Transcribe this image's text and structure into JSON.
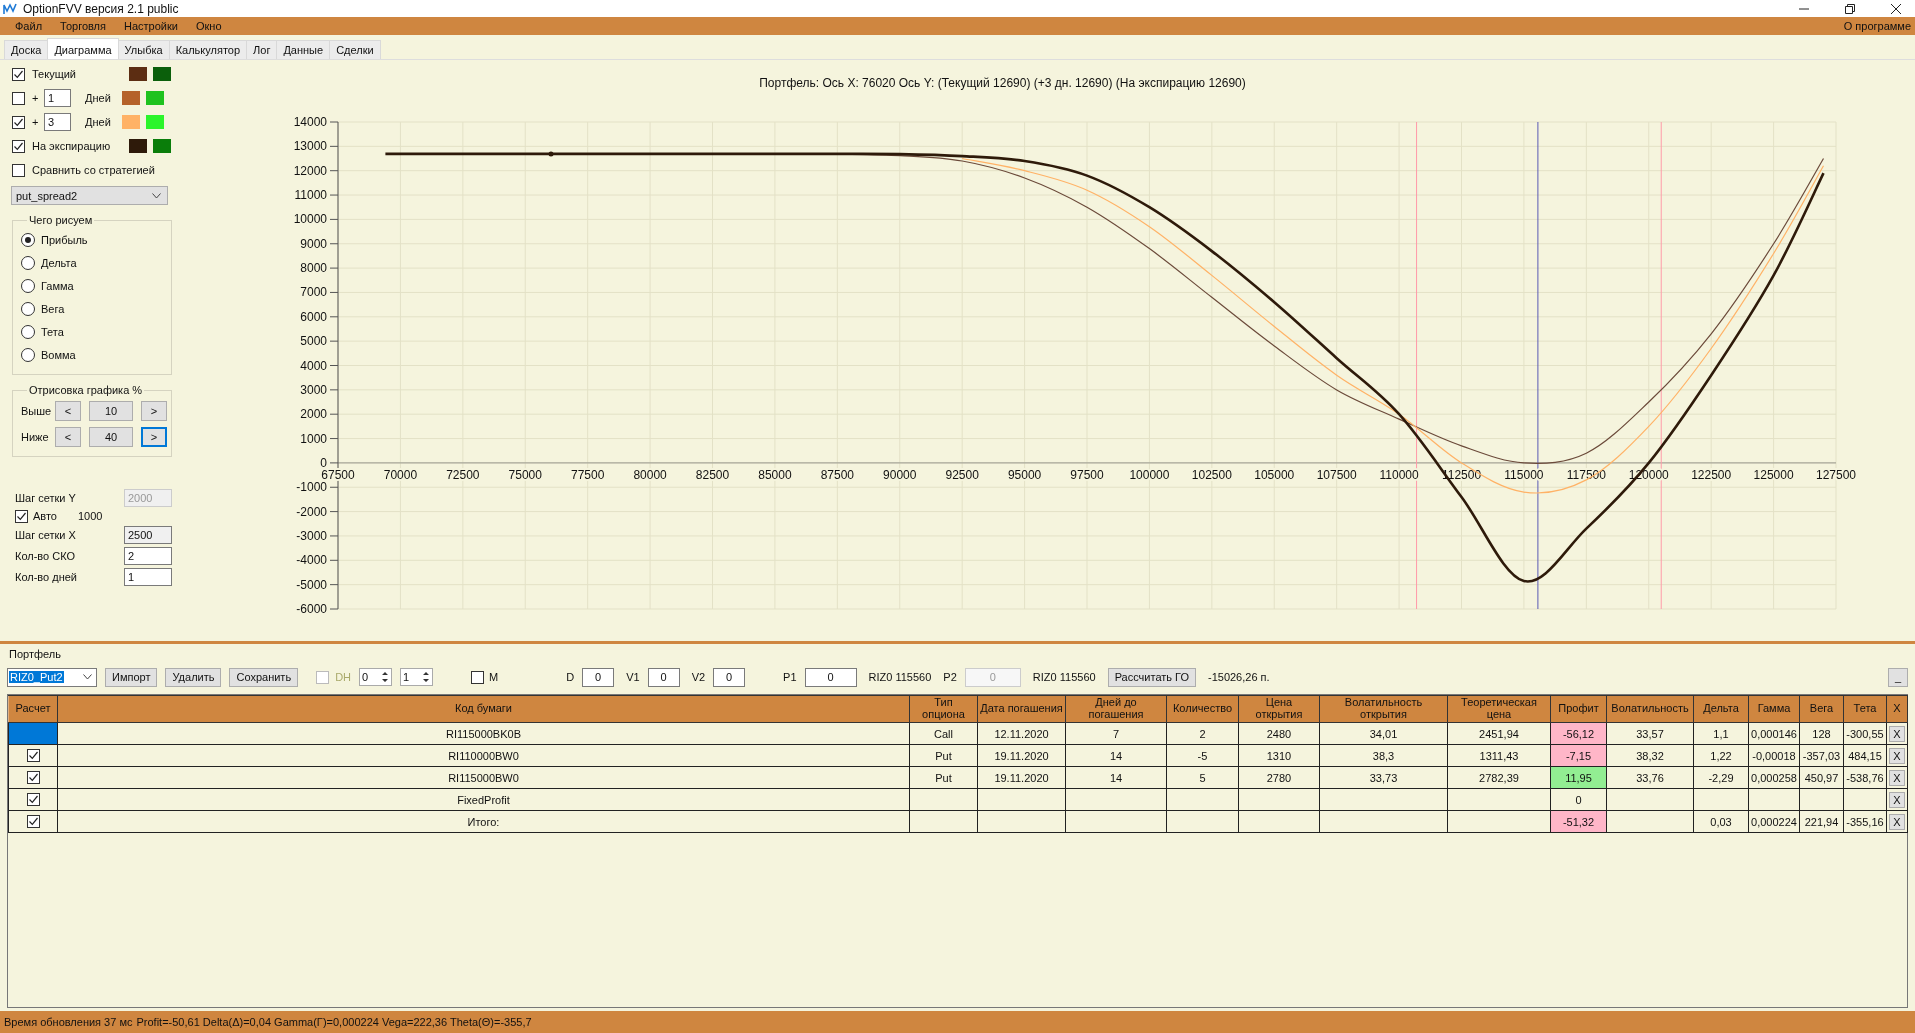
{
  "window": {
    "title": "OptionFVV версия 2.1 public"
  },
  "menu": [
    {
      "label": "Файл"
    },
    {
      "label": "Торговля"
    },
    {
      "label": "Настройки"
    },
    {
      "label": "Окно"
    }
  ],
  "menu_right": {
    "label": "О программе"
  },
  "tabs": [
    {
      "label": "Доска",
      "selected": false
    },
    {
      "label": "Диаграмма",
      "selected": true
    },
    {
      "label": "Улыбка",
      "selected": false
    },
    {
      "label": "Калькулятор",
      "selected": false
    },
    {
      "label": "Лог",
      "selected": false
    },
    {
      "label": "Данные",
      "selected": false
    },
    {
      "label": "Сделки",
      "selected": false
    }
  ],
  "series_toggles": [
    {
      "kind": "plain",
      "label": "Текущий",
      "checked": true,
      "swatches": [
        {
          "color": "#5c2d12"
        },
        {
          "color": "#0b5f0b"
        }
      ]
    },
    {
      "kind": "days",
      "prefix": "+",
      "days": "1",
      "unit": "Дней",
      "checked": false,
      "swatches": [
        {
          "color": "#b5622a"
        },
        {
          "color": "#1ec21e"
        }
      ]
    },
    {
      "kind": "days",
      "prefix": "+",
      "days": "3",
      "unit": "Дней",
      "checked": true,
      "swatches": [
        {
          "color": "#ffb266"
        },
        {
          "color": "#2bf52b"
        }
      ]
    },
    {
      "kind": "plain",
      "label": "На экспирацию",
      "checked": true,
      "swatches": [
        {
          "color": "#2e1a0a"
        },
        {
          "color": "#0a7d0a"
        }
      ]
    }
  ],
  "compare": {
    "label": "Сравнить со стратегией",
    "checked": false
  },
  "strategy_select": {
    "value": "put_spread2"
  },
  "draw_what": {
    "title": "Чего рисуем",
    "options": [
      {
        "label": "Прибыль",
        "selected": true
      },
      {
        "label": "Дельта",
        "selected": false
      },
      {
        "label": "Гамма",
        "selected": false
      },
      {
        "label": "Вега",
        "selected": false
      },
      {
        "label": "Тета",
        "selected": false
      },
      {
        "label": "Вомма",
        "selected": false
      }
    ]
  },
  "draw_range": {
    "title": "Отрисовка графика %",
    "rows": [
      {
        "label": "Выше",
        "prev": "<",
        "value": "10",
        "next": ">",
        "focused": false
      },
      {
        "label": "Ниже",
        "prev": "<",
        "value": "40",
        "next": ">",
        "focused": true
      }
    ]
  },
  "settings": [
    {
      "kind": "field",
      "label": "Шаг сетки Y",
      "value": "2000",
      "disabled": true,
      "readonly": false
    },
    {
      "kind": "check",
      "label": "Авто",
      "checked": true,
      "value": "1000"
    },
    {
      "kind": "field",
      "label": "Шаг сетки X",
      "value": "2500",
      "disabled": false,
      "readonly": true
    },
    {
      "kind": "field",
      "label": "Кол-во СКО",
      "value": "2",
      "disabled": false,
      "readonly": false
    },
    {
      "kind": "field",
      "label": "Кол-во дней",
      "value": "1",
      "disabled": false,
      "readonly": false
    }
  ],
  "chart": {
    "title": "Портфель: Ось X: 76020 Ось Y:  (Текущий 12690)  (+3 дн. 12690)  (На экспирацию 12690)",
    "chart_data": {
      "type": "line",
      "x": [
        69400,
        72500,
        77500,
        82500,
        87500,
        90000,
        92500,
        95000,
        97500,
        100000,
        102500,
        105000,
        107500,
        110000,
        112500,
        115000,
        117500,
        120000,
        122500,
        125000,
        127000
      ],
      "series": [
        {
          "color": "#6b4a3a",
          "values": [
            null,
            null,
            null,
            null,
            12680,
            12620,
            12400,
            11700,
            10500,
            8800,
            6800,
            4800,
            3000,
            1800,
            700,
            0,
            400,
            2500,
            5300,
            9000,
            12500
          ]
        },
        {
          "color": "#ffb266",
          "values": [
            null,
            null,
            null,
            null,
            null,
            null,
            12500,
            12000,
            11200,
            9700,
            7700,
            5600,
            3600,
            2000,
            0,
            -1200,
            -700,
            1500,
            4700,
            8600,
            12200
          ]
        },
        {
          "color": "#2e1a0a",
          "values": [
            12690,
            12690,
            12690,
            12690,
            12690,
            12680,
            12600,
            12400,
            11800,
            10500,
            8700,
            6600,
            4300,
            2000,
            -1400,
            -4850,
            -2700,
            0,
            3600,
            7700,
            11900
          ]
        }
      ],
      "xlim": [
        67500,
        127500
      ],
      "ylim": [
        -6000,
        14000
      ],
      "xticks": [
        67500,
        70000,
        72500,
        75000,
        77500,
        80000,
        82500,
        85000,
        87500,
        90000,
        92500,
        95000,
        97500,
        100000,
        102500,
        105000,
        107500,
        110000,
        112500,
        115000,
        117500,
        120000,
        122500,
        125000,
        127500
      ],
      "yticks": [
        -6000,
        -5000,
        -4000,
        -3000,
        -2000,
        -1000,
        0,
        1000,
        2000,
        3000,
        4000,
        5000,
        6000,
        7000,
        8000,
        9000,
        10000,
        11000,
        12000,
        13000,
        14000
      ],
      "grid": true,
      "ref_lines": [
        {
          "axis": "x",
          "value": 110700,
          "color": "#ff9aa8"
        },
        {
          "axis": "x",
          "value": 115560,
          "color": "#5a5ab4"
        },
        {
          "axis": "x",
          "value": 120500,
          "color": "#ff9aa8"
        }
      ]
    }
  },
  "portfolio": {
    "title": "Портфель",
    "select": "RIZ0_Put2",
    "buttons": [
      {
        "label": "Импорт"
      },
      {
        "label": "Удалить"
      },
      {
        "label": "Сохранить"
      }
    ],
    "dh": {
      "label": "DH",
      "checked": false,
      "disabled": true
    },
    "spinners": [
      "0",
      "1"
    ],
    "m": {
      "label": "M",
      "checked": false
    },
    "params": [
      {
        "label": "D",
        "value": "0"
      },
      {
        "label": "V1",
        "value": "0"
      },
      {
        "label": "V2",
        "value": "0"
      },
      {
        "label": "P1",
        "value": "0"
      }
    ],
    "ticker_1": "RIZ0 115560",
    "p2": {
      "label": "P2",
      "value": "0",
      "disabled": true
    },
    "ticker_2": "RIZ0 115560",
    "go_button": "Рассчитать ГО",
    "go_value": "-15026,26 п.",
    "minimize": "_"
  },
  "table": {
    "columns": [
      "Расчет",
      "Код бумаги",
      "Тип опциона",
      "Дата погашения",
      "Дней до погашения",
      "Количество",
      "Цена открытия",
      "Волатильность открытия",
      "Теоретическая цена",
      "Профит",
      "Волатильность",
      "Дельта",
      "Гамма",
      "Вега",
      "Тета",
      "X"
    ],
    "rows": [
      {
        "selected": true,
        "cells": [
          "",
          "RI115000BK0B",
          "Call",
          "12.11.2020",
          "7",
          "2",
          "2480",
          "34,01",
          "2451,94",
          "-56,12",
          "33,57",
          "1,1",
          "0,000146",
          "128",
          "-300,55",
          "X"
        ],
        "color": "#ffb6c8"
      },
      {
        "selected": false,
        "checked": true,
        "cells": [
          "",
          "RI110000BW0",
          "Put",
          "19.11.2020",
          "14",
          "-5",
          "1310",
          "38,3",
          "1311,43",
          "-7,15",
          "38,32",
          "1,22",
          "-0,00018",
          "-357,03",
          "484,15",
          "X"
        ],
        "color": "#ffb6c8"
      },
      {
        "selected": false,
        "checked": true,
        "cells": [
          "",
          "RI115000BW0",
          "Put",
          "19.11.2020",
          "14",
          "5",
          "2780",
          "33,73",
          "2782,39",
          "11,95",
          "33,76",
          "-2,29",
          "0,000258",
          "450,97",
          "-538,76",
          "X"
        ],
        "color": "#92ee92"
      },
      {
        "selected": false,
        "checked": true,
        "cells": [
          "",
          "FixedProfit",
          "",
          "",
          "",
          "",
          "",
          "",
          "",
          "0",
          "",
          "",
          "",
          "",
          "",
          "X"
        ]
      },
      {
        "selected": false,
        "checked": true,
        "cells": [
          "",
          "Итого:",
          "",
          "",
          "",
          "",
          "",
          "",
          "",
          "-51,32",
          "",
          "0,03",
          "0,000224",
          "221,94",
          "-355,16",
          "X"
        ],
        "color": "#ffb6c8"
      }
    ]
  },
  "status_bar": {
    "update_time": "Время обновления 37 мс",
    "summary": "Profit=-50,61 Delta(Δ)=0,04 Gamma(Γ)=0,000224 Vega=222,36 Theta(Θ)=-355,7"
  }
}
